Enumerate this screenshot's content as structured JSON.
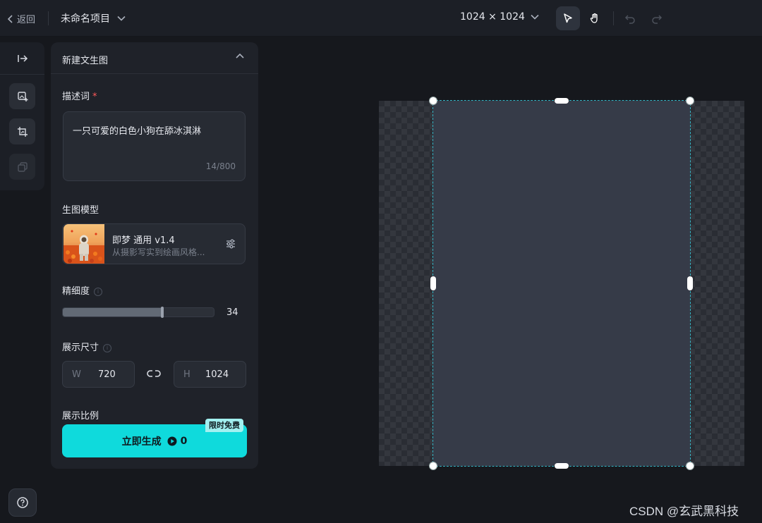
{
  "topbar": {
    "back_label": "返回",
    "project_name": "未命名项目",
    "canvas_size": "1024 × 1024"
  },
  "panel": {
    "title": "新建文生图",
    "prompt": {
      "label": "描述词",
      "required_mark": "*",
      "value": "一只可爱的白色小狗在舔冰淇淋",
      "counter": "14/800"
    },
    "model": {
      "label": "生图模型",
      "name": "即梦 通用 v1.4",
      "description": "从摄影写实到绘画风格..."
    },
    "detail": {
      "label": "精细度",
      "value": "34",
      "fill_fraction": 0.66
    },
    "size": {
      "label": "展示尺寸",
      "width_key": "W",
      "width_value": "720",
      "height_key": "H",
      "height_value": "1024"
    },
    "ratio": {
      "label": "展示比例"
    },
    "generate": {
      "label": "立即生成",
      "cost": "0",
      "badge": "限时免费"
    }
  },
  "watermark": "CSDN @玄武黑科技",
  "colors": {
    "accent": "#0fdadc",
    "background": "#16181d",
    "panel": "#1f2229"
  }
}
